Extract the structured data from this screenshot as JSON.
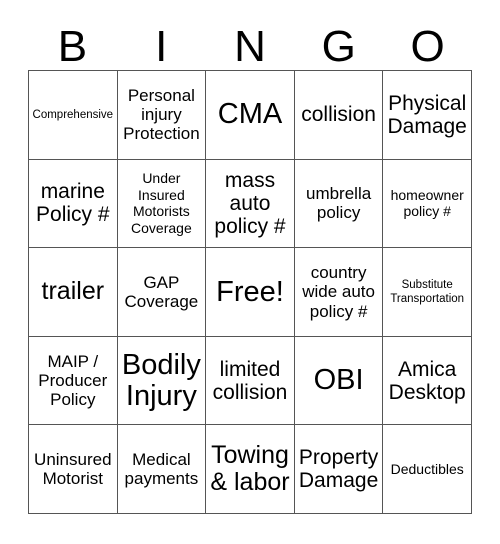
{
  "card": {
    "title_letters": [
      "B",
      "I",
      "N",
      "G",
      "O"
    ],
    "free_space_label": "Free!",
    "columns": 5,
    "rows": 5,
    "border_color": "#555555",
    "text_color": "#000000",
    "background_color": "#ffffff",
    "cells": [
      [
        {
          "text": "Comprehensive",
          "size": "tiny"
        },
        {
          "text": "Personal injury Protection",
          "size": "med"
        },
        {
          "text": "CMA",
          "size": "xxl"
        },
        {
          "text": "collision",
          "size": "large"
        },
        {
          "text": "Physical Damage",
          "size": "large"
        }
      ],
      [
        {
          "text": "marine Policy #",
          "size": "large"
        },
        {
          "text": "Under Insured Motorists Coverage",
          "size": "small"
        },
        {
          "text": "mass auto policy #",
          "size": "large"
        },
        {
          "text": "umbrella policy",
          "size": "med"
        },
        {
          "text": "homeowner policy #",
          "size": "small"
        }
      ],
      [
        {
          "text": "trailer",
          "size": "xl"
        },
        {
          "text": "GAP Coverage",
          "size": "med"
        },
        {
          "text": "Free!",
          "size": "xxl"
        },
        {
          "text": "country wide auto policy #",
          "size": "med"
        },
        {
          "text": "Substitute Transportation",
          "size": "tiny"
        }
      ],
      [
        {
          "text": "MAIP / Producer Policy",
          "size": "med"
        },
        {
          "text": "Bodily Injury",
          "size": "xxl"
        },
        {
          "text": "limited collision",
          "size": "large"
        },
        {
          "text": "OBI",
          "size": "xxl"
        },
        {
          "text": "Amica Desktop",
          "size": "large"
        }
      ],
      [
        {
          "text": "Uninsured Motorist",
          "size": "med"
        },
        {
          "text": "Medical payments",
          "size": "med"
        },
        {
          "text": "Towing & labor",
          "size": "xl"
        },
        {
          "text": "Property Damage",
          "size": "large"
        },
        {
          "text": "Deductibles",
          "size": "small"
        }
      ]
    ]
  }
}
